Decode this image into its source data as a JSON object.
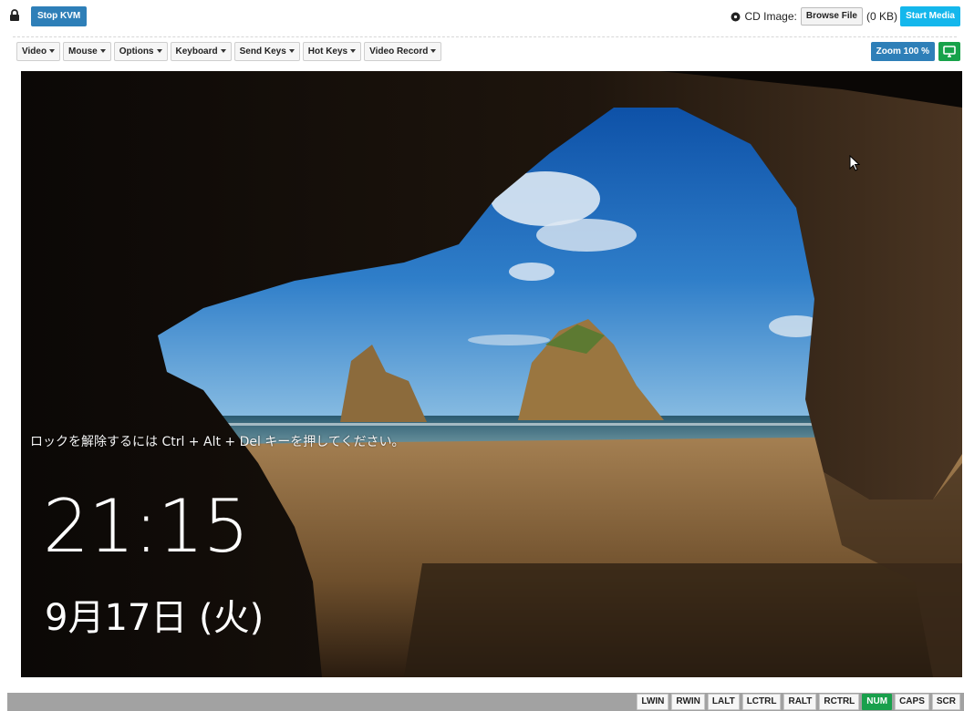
{
  "topbar": {
    "stop_kvm_label": "Stop KVM",
    "cd_image_label": "CD Image:",
    "browse_file_label": "Browse File",
    "file_size": "(0 KB)",
    "start_media_label": "Start Media"
  },
  "menubar": {
    "items": [
      {
        "label": "Video"
      },
      {
        "label": "Mouse"
      },
      {
        "label": "Options"
      },
      {
        "label": "Keyboard"
      },
      {
        "label": "Send Keys"
      },
      {
        "label": "Hot Keys"
      },
      {
        "label": "Video Record"
      }
    ],
    "zoom_label": "Zoom 100 %"
  },
  "screen": {
    "lock_hint": "ロックを解除するには Ctrl + Alt + Del キーを押してください。",
    "time": "21:15",
    "date": "9月17日 (火)"
  },
  "statusbar": {
    "keys": [
      {
        "label": "LWIN",
        "active": false
      },
      {
        "label": "RWIN",
        "active": false
      },
      {
        "label": "LALT",
        "active": false
      },
      {
        "label": "LCTRL",
        "active": false
      },
      {
        "label": "RALT",
        "active": false
      },
      {
        "label": "RCTRL",
        "active": false
      },
      {
        "label": "NUM",
        "active": true
      },
      {
        "label": "CAPS",
        "active": false
      },
      {
        "label": "SCR",
        "active": false
      }
    ]
  },
  "icons": {
    "lock": "lock-icon",
    "cd": "disc-icon",
    "screen": "monitor-icon",
    "cursor": "mouse-cursor-icon"
  },
  "colors": {
    "primary": "#2e7fb8",
    "start_media": "#14b7ec",
    "active_key": "#19a04c",
    "statusbar": "#a2a2a2"
  }
}
